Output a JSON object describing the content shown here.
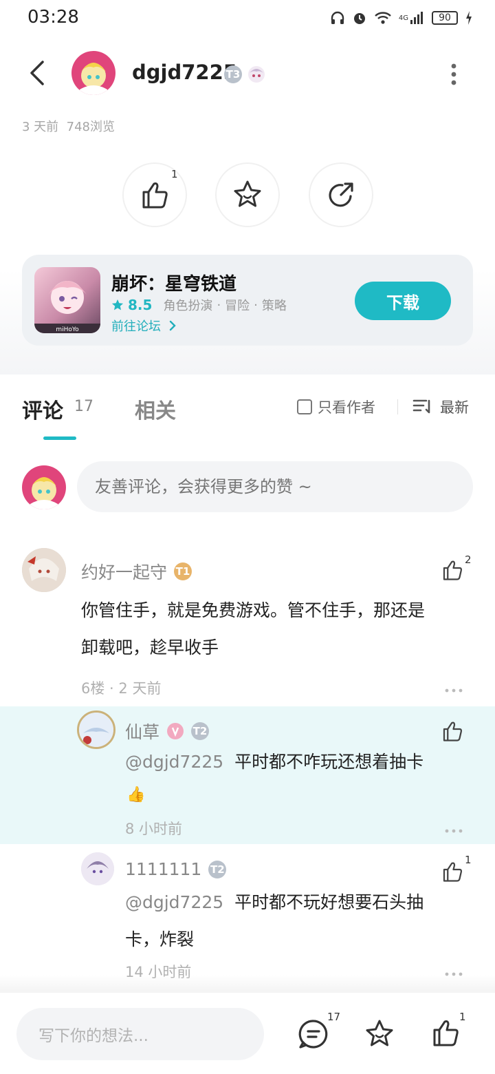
{
  "status_bar": {
    "time": "03:28",
    "battery": "90",
    "network": "4G",
    "icons": [
      "headphones-icon",
      "alarm-icon",
      "wifi-icon",
      "signal-icon",
      "battery-icon",
      "charging-icon"
    ]
  },
  "header": {
    "author": "dgjd7225",
    "level_badge": "T3"
  },
  "post_meta": {
    "age": "3 天前",
    "views": "748浏览"
  },
  "actions": {
    "like_count": "1"
  },
  "game": {
    "title": "崩坏：星穹铁道",
    "rating": "8.5",
    "tags": [
      "角色扮演",
      "冒险",
      "策略"
    ],
    "forum_link": "前往论坛",
    "download_label": "下载"
  },
  "tabs": {
    "comments_label": "评论",
    "comments_count": "17",
    "related_label": "相关",
    "author_only_label": "只看作者",
    "sort_label": "最新"
  },
  "comment_input": {
    "placeholder": "友善评论，会获得更多的赞 ~"
  },
  "comments": [
    {
      "user": "约好一起守",
      "badge": "T1",
      "text_line1": "你管住手，就是免费游戏。管不住手，那还是",
      "text_line2": "卸载吧，趁早收手",
      "floor": "6楼",
      "time": "2 天前",
      "likes": "2"
    },
    {
      "user": "仙草",
      "badge": "T2",
      "mention": "@dgjd7225",
      "text": "平时都不咋玩还想着抽卡",
      "emoji": "👍",
      "time": "8 小时前"
    },
    {
      "user": "1111111",
      "badge": "T2",
      "mention": "@dgjd7225",
      "text_line1": "平时都不玩好想要石头抽",
      "text_line2": "卡，炸裂",
      "time": "14 小时前",
      "likes": "1"
    }
  ],
  "bottom_bar": {
    "placeholder": "写下你的想法...",
    "comment_count": "17",
    "like_count": "1"
  },
  "colors": {
    "accent": "#1fbac5",
    "reply_highlight": "#e9f8f9"
  }
}
